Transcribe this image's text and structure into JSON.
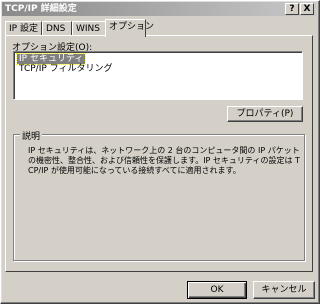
{
  "window": {
    "title": "TCP/IP 詳細設定",
    "help_button": "?",
    "close_button": "X"
  },
  "tabs": [
    {
      "label": "IP 設定"
    },
    {
      "label": "DNS"
    },
    {
      "label": "WINS"
    },
    {
      "label": "オプション"
    }
  ],
  "options_panel": {
    "list_label": "オプション設定(O):",
    "items": [
      {
        "label": "IP セキュリティ"
      },
      {
        "label": "TCP/IP フィルタリング"
      }
    ],
    "properties_button": "プロパティ(P)"
  },
  "description": {
    "legend": "説明",
    "text": "IP セキュリティは、ネットワーク上の 2 台のコンピュータ間の IP パケットの機密性、整合性、および信頼性を保護します。IP セキュリティの設定は TCP/IP が使用可能になっている接続すべてに適用されます。"
  },
  "footer": {
    "ok_label": "OK",
    "cancel_label": "キャンセル"
  }
}
